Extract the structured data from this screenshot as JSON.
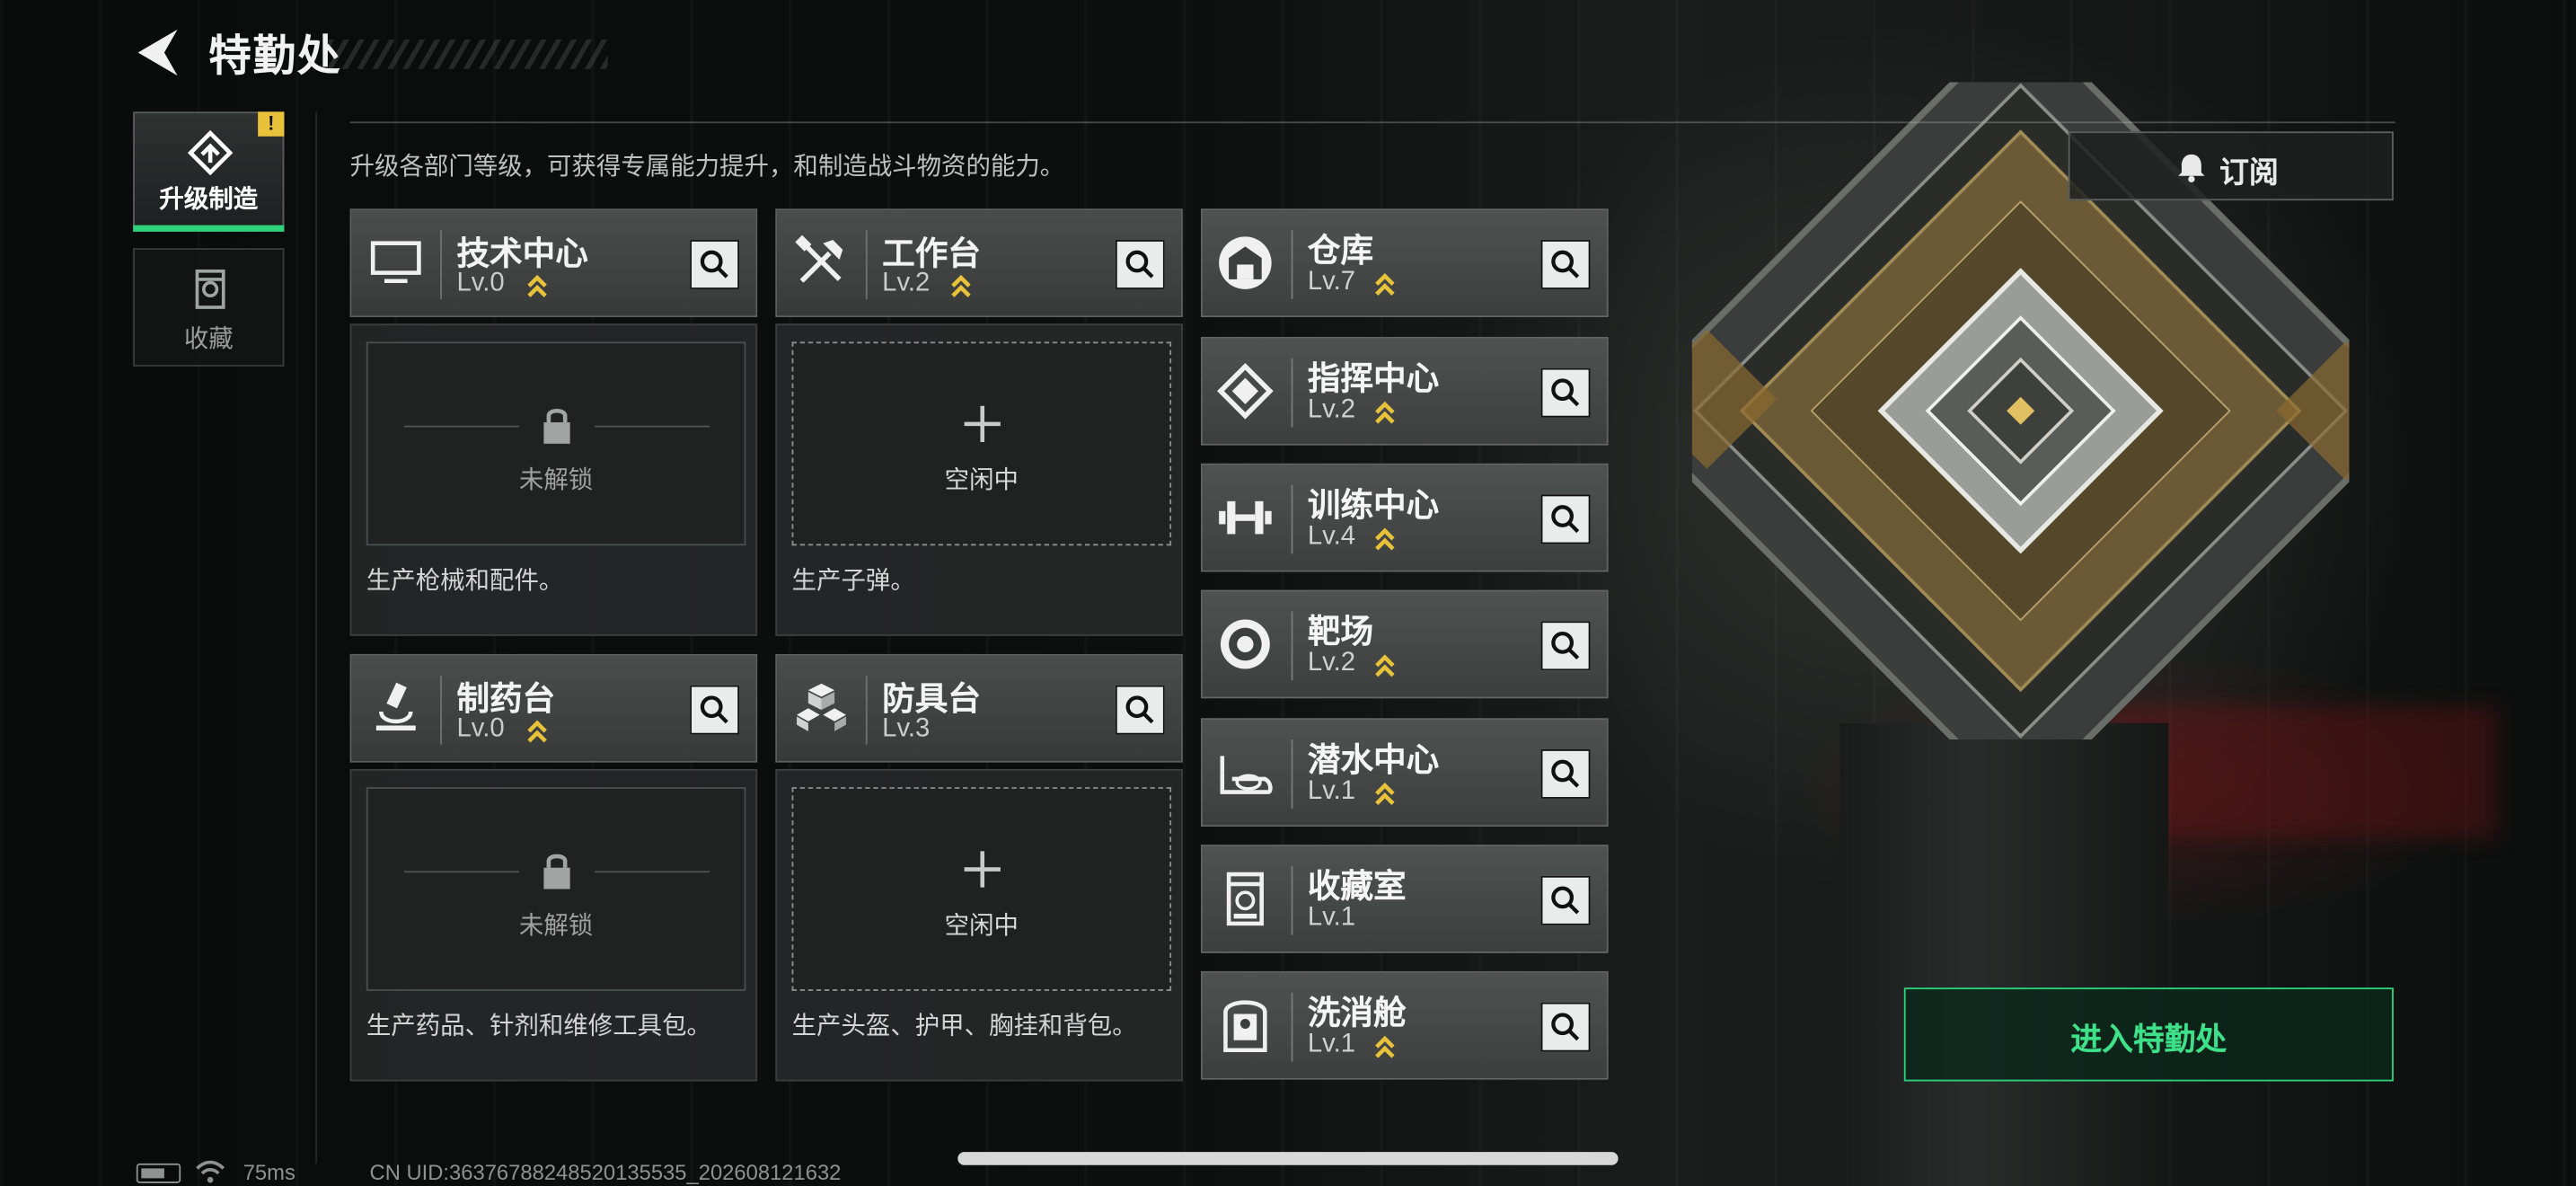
{
  "header": {
    "title": "特勤处"
  },
  "nav": [
    {
      "label": "升级制造",
      "active": true,
      "alert": "!"
    },
    {
      "label": "收藏",
      "active": false
    }
  ],
  "description": "升级各部门等级，可获得专属能力提升，和制造战斗物资的能力。",
  "subscribe": {
    "label": "订阅",
    "icon": "bell-icon"
  },
  "stations": [
    {
      "name": "技术中心",
      "level": "Lv.0",
      "upgradable": true,
      "icon": "monitor-icon",
      "slot_state": "未解锁",
      "slot_locked": true,
      "product": "生产枪械和配件。"
    },
    {
      "name": "工作台",
      "level": "Lv.2",
      "upgradable": true,
      "icon": "tools-icon",
      "slot_state": "空闲中",
      "slot_locked": false,
      "product": "生产子弹。"
    },
    {
      "name": "制药台",
      "level": "Lv.0",
      "upgradable": true,
      "icon": "microscope-icon",
      "slot_state": "未解锁",
      "slot_locked": true,
      "product": "生产药品、针剂和维修工具包。"
    },
    {
      "name": "防具台",
      "level": "Lv.3",
      "upgradable": false,
      "icon": "cubes-icon",
      "slot_state": "空闲中",
      "slot_locked": false,
      "product": "生产头盔、护甲、胸挂和背包。"
    }
  ],
  "departments": [
    {
      "name": "仓库",
      "level": "Lv.7",
      "upgradable": true,
      "icon": "warehouse-icon"
    },
    {
      "name": "指挥中心",
      "level": "Lv.2",
      "upgradable": true,
      "icon": "chip-icon"
    },
    {
      "name": "训练中心",
      "level": "Lv.4",
      "upgradable": true,
      "icon": "dumbbell-icon"
    },
    {
      "name": "靶场",
      "level": "Lv.2",
      "upgradable": true,
      "icon": "target-icon"
    },
    {
      "name": "潜水中心",
      "level": "Lv.1",
      "upgradable": true,
      "icon": "diving-mask-icon"
    },
    {
      "name": "收藏室",
      "level": "Lv.1",
      "upgradable": false,
      "icon": "display-case-icon"
    },
    {
      "name": "洗消舱",
      "level": "Lv.1",
      "upgradable": true,
      "icon": "decon-pod-icon"
    }
  ],
  "enter_button": {
    "label": "进入特勤处"
  },
  "status_bar": {
    "ping": "75ms",
    "uid": "CN UID:36376788248520135535_202608121632"
  },
  "colors": {
    "accent": "#2fd17a",
    "upgrade": "#e8c23a",
    "alert": "#e8c23a"
  }
}
